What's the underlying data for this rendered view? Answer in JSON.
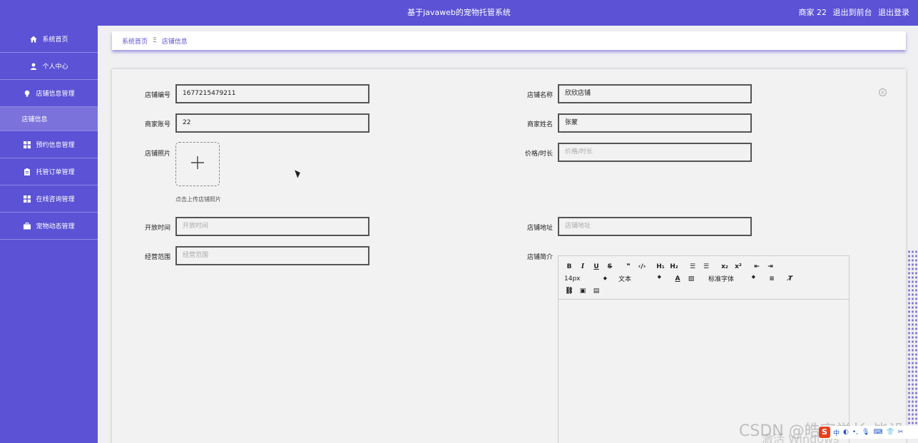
{
  "header": {
    "title": "基于javaweb的宠物托管系统",
    "user": "商家 22",
    "back_front": "退出到前台",
    "logout": "退出登录"
  },
  "sidebar": {
    "items": [
      {
        "label": "系统首页",
        "icon": "home-icon"
      },
      {
        "label": "个人中心",
        "icon": "user-icon"
      },
      {
        "label": "店铺信息管理",
        "icon": "bulb-icon"
      },
      {
        "label": "预约信息管理",
        "icon": "grid-icon"
      },
      {
        "label": "托管订单管理",
        "icon": "clipboard-icon"
      },
      {
        "label": "在线咨询管理",
        "icon": "grid-icon"
      },
      {
        "label": "宠物动态管理",
        "icon": "briefcase-icon"
      }
    ],
    "sub_item": "店铺信息"
  },
  "breadcrumb": {
    "home": "系统首页",
    "separator": "Ξ",
    "current": "店铺信息"
  },
  "form": {
    "shop_no_label": "店铺编号",
    "shop_no_value": "1677215479211",
    "shop_name_label": "店铺名称",
    "shop_name_value": "欣欣店铺",
    "merchant_account_label": "商家账号",
    "merchant_account_value": "22",
    "merchant_name_label": "商家姓名",
    "merchant_name_value": "张蒙",
    "shop_photo_label": "店铺照片",
    "upload_tip": "点击上传店铺照片",
    "price_label": "价格/时长",
    "price_placeholder": "价格/时长",
    "open_time_label": "开放时间",
    "open_time_placeholder": "开放时间",
    "address_label": "店铺地址",
    "address_placeholder": "店铺地址",
    "scope_label": "经营范围",
    "scope_placeholder": "经营范围",
    "intro_label": "店铺简介"
  },
  "editor": {
    "font_size": "14px",
    "paragraph": "文本",
    "font_family": "标准字体"
  },
  "watermark": {
    "csdn": "CSDN @皓宇学长-毕设",
    "windows": "激活 Windows"
  },
  "tray": {
    "ime": "中"
  },
  "colors": {
    "brand": "#5b52d6",
    "sub_item_bg": "#7b73db"
  }
}
